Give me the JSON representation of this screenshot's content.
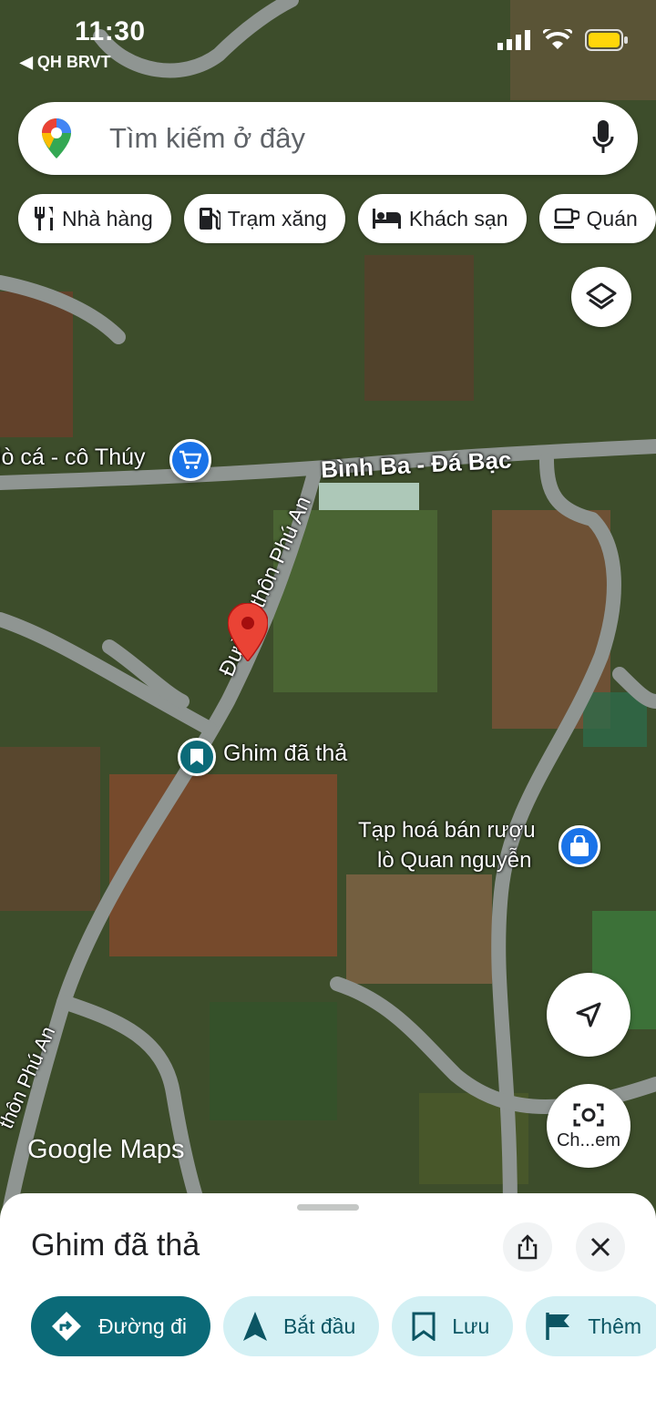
{
  "status_bar": {
    "time": "11:30",
    "back_label": "◀ QH BRVT"
  },
  "search": {
    "placeholder": "Tìm kiếm ở đây"
  },
  "chips": [
    {
      "label": "Nhà hàng",
      "icon": "restaurant-icon"
    },
    {
      "label": "Trạm xăng",
      "icon": "gas-station-icon"
    },
    {
      "label": "Khách sạn",
      "icon": "hotel-icon"
    },
    {
      "label": "Quán",
      "icon": "cafe-icon"
    }
  ],
  "map_labels": {
    "road_main": "Bình Ba - Đá Bạc",
    "road_side": "Đường thôn Phú An",
    "road_side2": "thôn Phú An",
    "shop_left": "iò cá - cô Thúy",
    "shop_right_line1": "Tạp hoá bán rượu",
    "shop_right_line2": "lò Quan nguyễn",
    "dropped_pin": "Ghim đã thả",
    "camera_button": "Ch...em",
    "watermark": "Google Maps"
  },
  "sheet": {
    "title": "Ghim đã thả",
    "actions": [
      {
        "label": "Đường đi",
        "icon": "directions-icon"
      },
      {
        "label": "Bắt đầu",
        "icon": "navigation-arrow-icon"
      },
      {
        "label": "Lưu",
        "icon": "bookmark-icon"
      },
      {
        "label": "Thêm",
        "icon": "flag-icon"
      }
    ]
  },
  "colors": {
    "accent": "#0b6a78",
    "pin_red": "#ea4335",
    "chip_blue": "#1a73e8"
  }
}
